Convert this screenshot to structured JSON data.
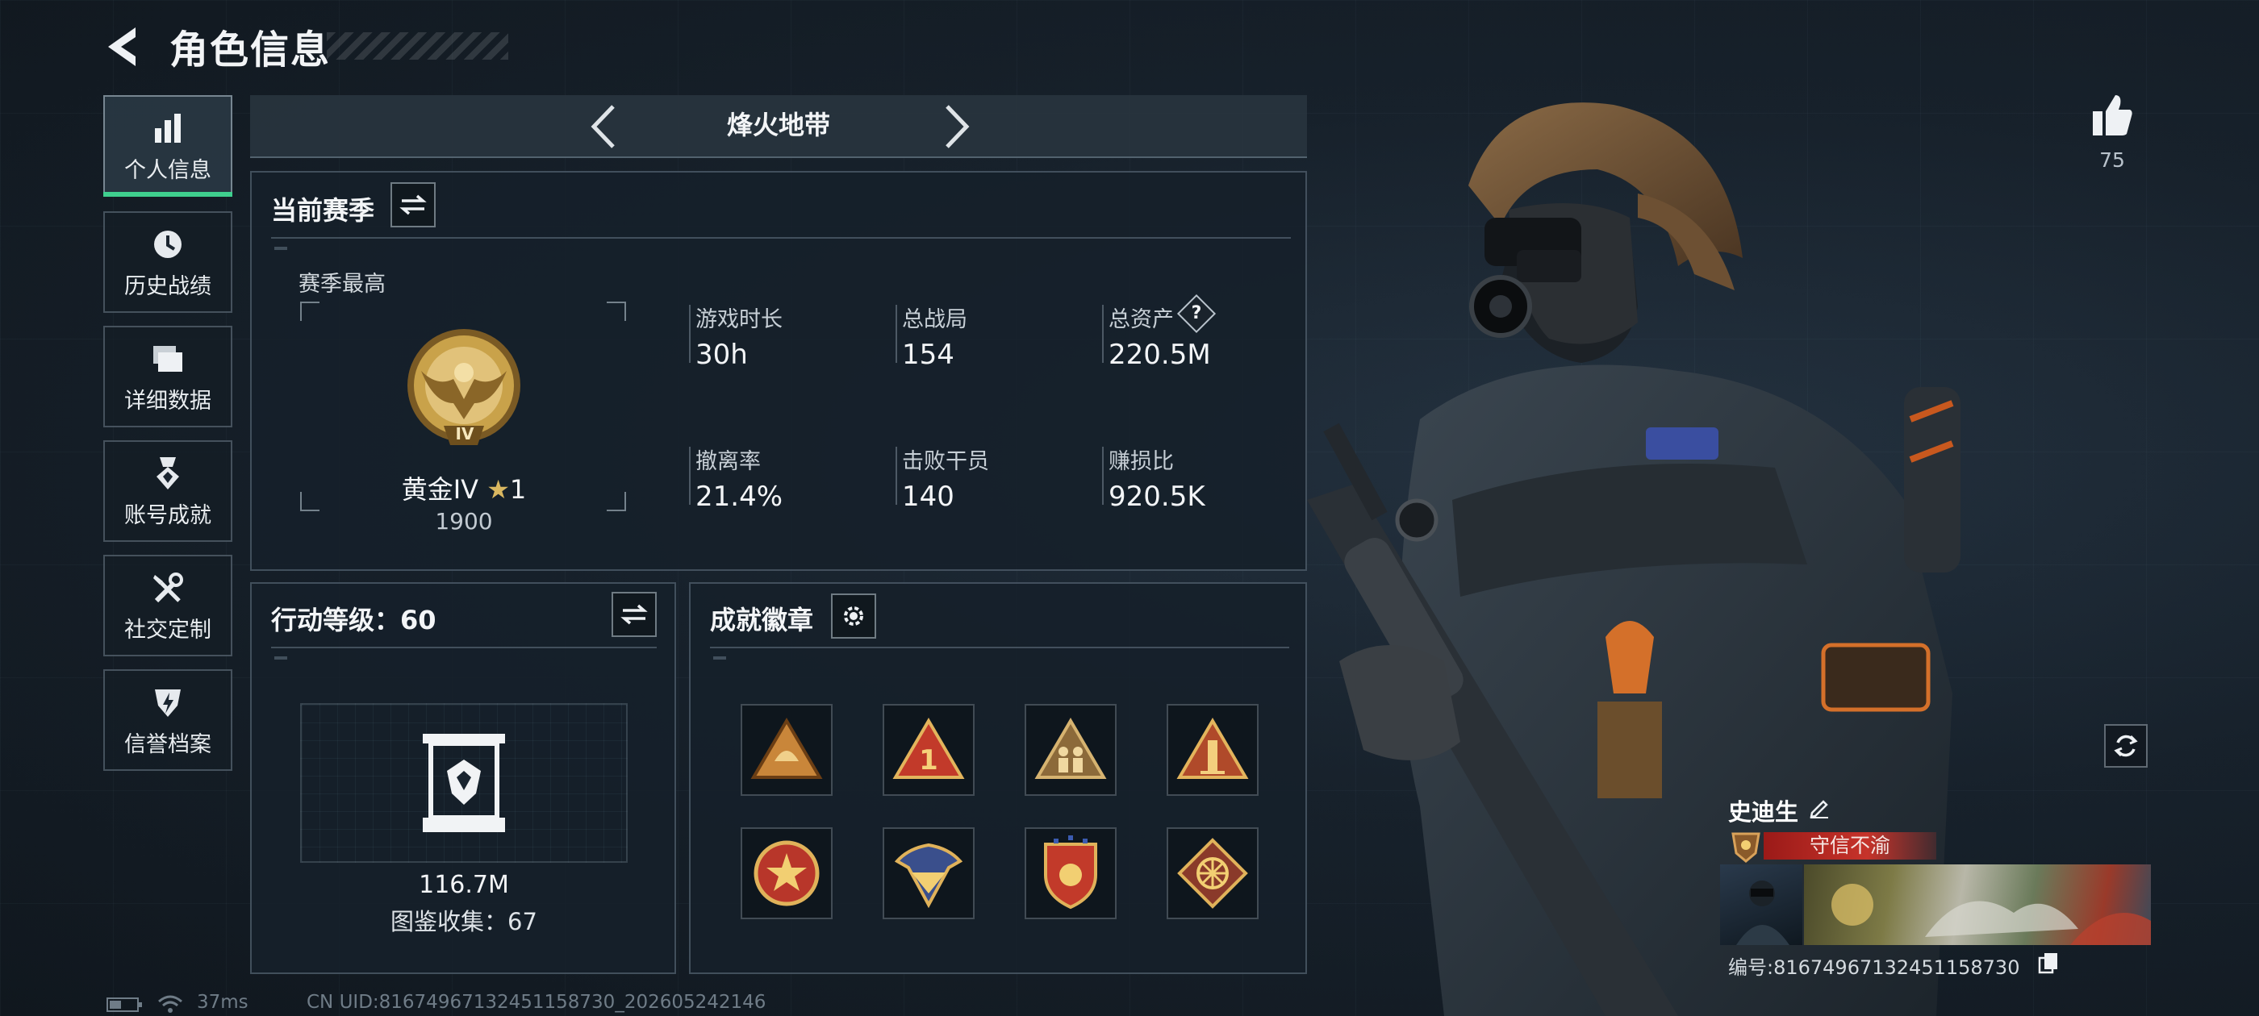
{
  "header": {
    "title": "角色信息"
  },
  "sidebar": {
    "items": [
      {
        "label": "个人信息",
        "icon": "bar-chart-icon",
        "active": true
      },
      {
        "label": "历史战绩",
        "icon": "clock-icon",
        "active": false
      },
      {
        "label": "详细数据",
        "icon": "folder-icon",
        "active": false
      },
      {
        "label": "账号成就",
        "icon": "medal-icon",
        "active": false
      },
      {
        "label": "社交定制",
        "icon": "tools-icon",
        "active": false
      },
      {
        "label": "信誉档案",
        "icon": "shield-icon",
        "active": false
      }
    ]
  },
  "mode": {
    "name": "烽火地带"
  },
  "season": {
    "title": "当前赛季",
    "best_label": "赛季最高",
    "rank_name": "黄金IV",
    "rank_emblem_text": "IV",
    "rank_stars": "1",
    "rank_points": "1900",
    "stats": [
      {
        "label": "游戏时长",
        "value": "30h"
      },
      {
        "label": "总战局",
        "value": "154"
      },
      {
        "label": "总资产",
        "value": "220.5M"
      },
      {
        "label": "撤离率",
        "value": "21.4%"
      },
      {
        "label": "击败干员",
        "value": "140"
      },
      {
        "label": "赚损比",
        "value": "920.5K"
      }
    ],
    "help_label": "?"
  },
  "action_level": {
    "title": "行动等级：60",
    "value": "116.7M",
    "collection": "图鉴收集：67"
  },
  "badges": {
    "title": "成就徽章",
    "items": [
      {
        "icon": "triangle-badge-helmet-icon"
      },
      {
        "icon": "triangle-badge-one-icon"
      },
      {
        "icon": "triangle-badge-soldiers-icon"
      },
      {
        "icon": "triangle-badge-tower-icon"
      },
      {
        "icon": "round-badge-star-icon"
      },
      {
        "icon": "shield-badge-wings-icon"
      },
      {
        "icon": "shield-badge-stars-icon"
      },
      {
        "icon": "diamond-badge-wheel-icon"
      }
    ]
  },
  "profile": {
    "likes": "75",
    "player_name": "史迪生",
    "title_banner": "守信不渝",
    "uid_label": "编号:81674967132451158730"
  },
  "footer": {
    "ping": "37ms",
    "uid": "CN UID:81674967132451158730_202605242146"
  },
  "colors": {
    "accent": "#3fcf8e",
    "gold": "#c9a24a",
    "banner_red": "#c6332a"
  }
}
